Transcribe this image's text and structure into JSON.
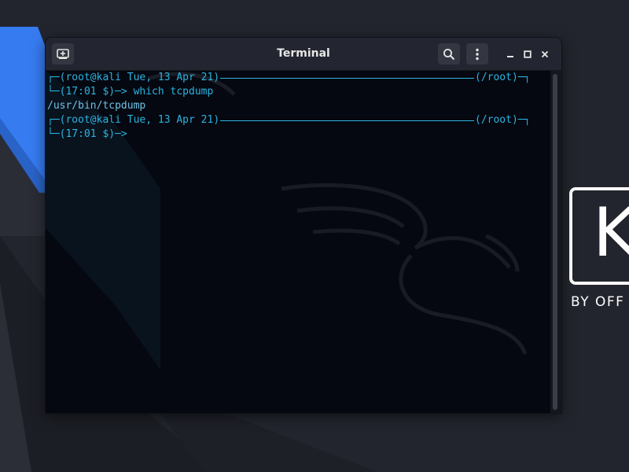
{
  "window": {
    "title": "Terminal",
    "new_tab_icon": "new-tab-icon",
    "search_icon": "search-icon",
    "menu_icon": "kebab-menu-icon",
    "minimize_icon": "minimize-icon",
    "maximize_icon": "maximize-icon",
    "close_icon": "close-icon"
  },
  "terminal": {
    "lines": [
      {
        "left": "┌─(root@kali Tue, 13 Apr 21)",
        "right": "(/root)─┐"
      },
      {
        "text": "└─(17:01 $)─> which tcpdump"
      },
      {
        "text": "/usr/bin/tcpdump"
      },
      {
        "left": "┌─(root@kali Tue, 13 Apr 21)",
        "right": "(/root)─┐"
      },
      {
        "text": "└─(17:01 $)─>"
      }
    ]
  },
  "wallpaper": {
    "brand_letter": "K",
    "brand_tagline": "BY OFF",
    "accent": "#367bf0",
    "background": "#23252e"
  },
  "colors": {
    "prompt": "#2bb3e0",
    "terminal_bg": "#050810",
    "titlebar_bg": "#232630"
  }
}
